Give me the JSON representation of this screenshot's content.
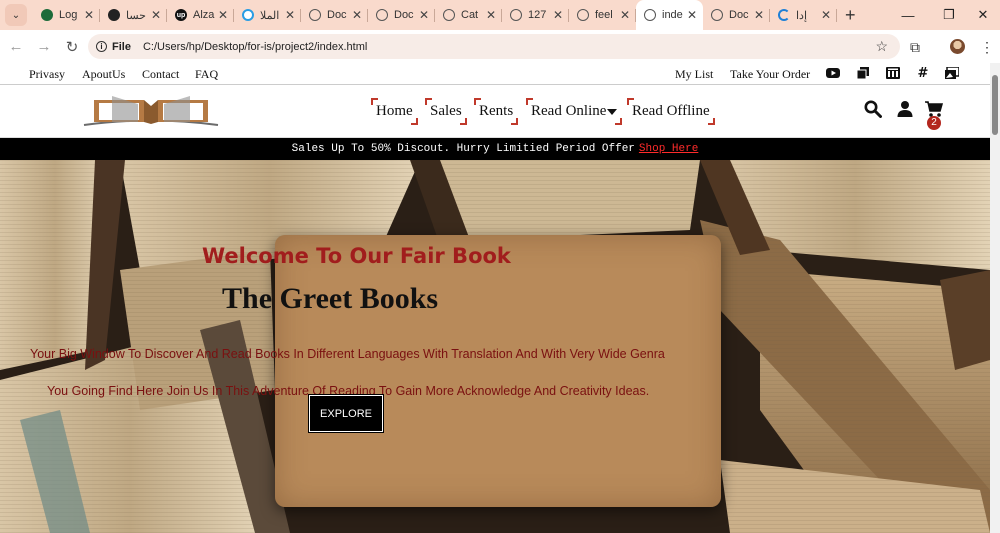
{
  "browser": {
    "tabs": [
      {
        "title": "Log",
        "favicon": "green-circle-icon"
      },
      {
        "title": "حسا",
        "favicon": "dark-swirl-icon"
      },
      {
        "title": "Alza",
        "favicon": "up-logo-icon"
      },
      {
        "title": "الملا",
        "favicon": "blue-ring-icon"
      },
      {
        "title": "Doc",
        "favicon": "globe-icon"
      },
      {
        "title": "Doc",
        "favicon": "globe-icon"
      },
      {
        "title": "Cat",
        "favicon": "globe-icon"
      },
      {
        "title": "127",
        "favicon": "globe-icon"
      },
      {
        "title": "feel",
        "favicon": "globe-icon"
      },
      {
        "title": "inde",
        "favicon": "globe-icon",
        "active": true
      },
      {
        "title": "Doc",
        "favicon": "globe-icon"
      },
      {
        "title": "إدا",
        "favicon": "swirl-icon"
      }
    ],
    "address": {
      "chip": "File",
      "url": "C:/Users/hp/Desktop/for-is/project2/index.html"
    }
  },
  "site": {
    "topbar": {
      "left_links": [
        "Privasy",
        "ApoutUs",
        "Contact",
        "FAQ"
      ],
      "right_links": [
        "My List",
        "Take Your Order"
      ],
      "social_icons": [
        "youtube-icon",
        "copy-icon",
        "bank-icon",
        "hashtag-icon",
        "images-icon"
      ]
    },
    "menu": [
      {
        "label": "Home"
      },
      {
        "label": "Sales"
      },
      {
        "label": "Rents"
      },
      {
        "label": "Read Online",
        "dropdown": true
      },
      {
        "label": "Read Offline"
      }
    ],
    "cart_count": "2",
    "promo": {
      "text": "Sales Up To 50% Discout. Hurry Limitied Period Offer",
      "link": "Shop Here"
    },
    "hero": {
      "welcome": "Welcome To Our Fair Book",
      "title": "The Greet Books",
      "line1": "Your Big Window To Discover And Read Books In Different Languages With Translation And With Very Wide Genra",
      "line2": "You Going Find Here Join Us In This Adventure Of Reading To Gain More Acknowledge And Creativity Ideas.",
      "button": "EXPLORE"
    }
  },
  "colors": {
    "accent_red": "#c0392b",
    "welcome_red": "#a11d1d",
    "tab_strip": "#f9dacc"
  }
}
